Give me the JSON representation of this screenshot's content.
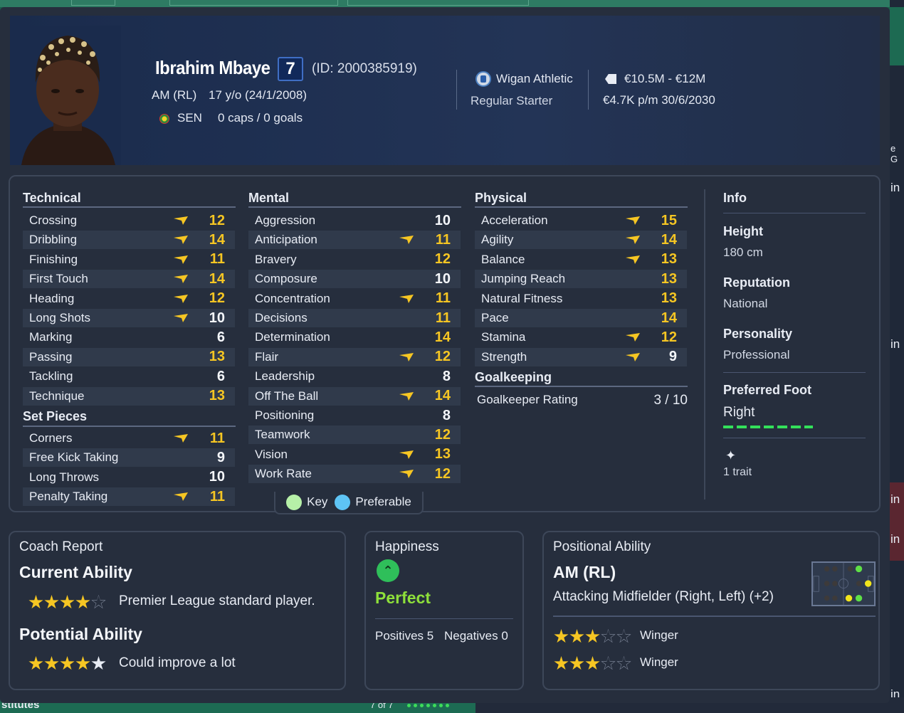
{
  "player": {
    "name": "Ibrahim Mbaye",
    "shirt_number": "7",
    "id_text": "(ID: 2000385919)",
    "position": "AM (RL)",
    "age_dob": "17 y/o (24/1/2008)",
    "nationality": "SEN",
    "caps_goals": "0 caps / 0 goals"
  },
  "club": {
    "name": "Wigan Athletic",
    "status": "Regular Starter",
    "value": "€10.5M - €12M",
    "wage_contract": "€4.7K p/m  30/6/2030"
  },
  "colors": {
    "highlight": "#f6c623",
    "normal": "#f4f6fa",
    "accent_green": "#33e05a",
    "key_dot": "#b6f0a8",
    "preferable_dot": "#5ec4f5"
  },
  "technical": {
    "title": "Technical",
    "rows": [
      {
        "label": "Crossing",
        "value": "12",
        "arrow": true,
        "hl": true
      },
      {
        "label": "Dribbling",
        "value": "14",
        "arrow": true,
        "hl": true
      },
      {
        "label": "Finishing",
        "value": "11",
        "arrow": true,
        "hl": true
      },
      {
        "label": "First Touch",
        "value": "14",
        "arrow": true,
        "hl": true
      },
      {
        "label": "Heading",
        "value": "12",
        "arrow": true,
        "hl": true
      },
      {
        "label": "Long Shots",
        "value": "10",
        "arrow": true,
        "hl": false
      },
      {
        "label": "Marking",
        "value": "6",
        "arrow": false,
        "hl": false
      },
      {
        "label": "Passing",
        "value": "13",
        "arrow": false,
        "hl": true
      },
      {
        "label": "Tackling",
        "value": "6",
        "arrow": false,
        "hl": false
      },
      {
        "label": "Technique",
        "value": "13",
        "arrow": false,
        "hl": true
      }
    ]
  },
  "set_pieces": {
    "title": "Set Pieces",
    "rows": [
      {
        "label": "Corners",
        "value": "11",
        "arrow": true,
        "hl": true
      },
      {
        "label": "Free Kick Taking",
        "value": "9",
        "arrow": false,
        "hl": false
      },
      {
        "label": "Long Throws",
        "value": "10",
        "arrow": false,
        "hl": false
      },
      {
        "label": "Penalty Taking",
        "value": "11",
        "arrow": true,
        "hl": true
      }
    ]
  },
  "mental": {
    "title": "Mental",
    "rows": [
      {
        "label": "Aggression",
        "value": "10",
        "arrow": false,
        "hl": false
      },
      {
        "label": "Anticipation",
        "value": "11",
        "arrow": true,
        "hl": true
      },
      {
        "label": "Bravery",
        "value": "12",
        "arrow": false,
        "hl": true
      },
      {
        "label": "Composure",
        "value": "10",
        "arrow": false,
        "hl": false
      },
      {
        "label": "Concentration",
        "value": "11",
        "arrow": true,
        "hl": true
      },
      {
        "label": "Decisions",
        "value": "11",
        "arrow": false,
        "hl": true
      },
      {
        "label": "Determination",
        "value": "14",
        "arrow": false,
        "hl": true
      },
      {
        "label": "Flair",
        "value": "12",
        "arrow": true,
        "hl": true
      },
      {
        "label": "Leadership",
        "value": "8",
        "arrow": false,
        "hl": false
      },
      {
        "label": "Off The Ball",
        "value": "14",
        "arrow": true,
        "hl": true
      },
      {
        "label": "Positioning",
        "value": "8",
        "arrow": false,
        "hl": false
      },
      {
        "label": "Teamwork",
        "value": "12",
        "arrow": false,
        "hl": true
      },
      {
        "label": "Vision",
        "value": "13",
        "arrow": true,
        "hl": true
      },
      {
        "label": "Work Rate",
        "value": "12",
        "arrow": true,
        "hl": true
      }
    ]
  },
  "physical": {
    "title": "Physical",
    "rows": [
      {
        "label": "Acceleration",
        "value": "15",
        "arrow": true,
        "hl": true
      },
      {
        "label": "Agility",
        "value": "14",
        "arrow": true,
        "hl": true
      },
      {
        "label": "Balance",
        "value": "13",
        "arrow": true,
        "hl": true
      },
      {
        "label": "Jumping Reach",
        "value": "13",
        "arrow": false,
        "hl": true
      },
      {
        "label": "Natural Fitness",
        "value": "13",
        "arrow": false,
        "hl": true
      },
      {
        "label": "Pace",
        "value": "14",
        "arrow": false,
        "hl": true
      },
      {
        "label": "Stamina",
        "value": "12",
        "arrow": true,
        "hl": true
      },
      {
        "label": "Strength",
        "value": "9",
        "arrow": true,
        "hl": false
      }
    ]
  },
  "goalkeeping": {
    "title": "Goalkeeping",
    "rating_label": "Goalkeeper Rating",
    "rating_value": "3 / 10"
  },
  "info": {
    "title": "Info",
    "height_label": "Height",
    "height_value": "180 cm",
    "reputation_label": "Reputation",
    "reputation_value": "National",
    "personality_label": "Personality",
    "personality_value": "Professional",
    "foot_label": "Preferred Foot",
    "foot_value": "Right",
    "traits": "1 trait"
  },
  "legend": {
    "key": "Key",
    "preferable": "Preferable"
  },
  "coach_report": {
    "title": "Coach Report",
    "current_label": "Current Ability",
    "current_stars": 4,
    "current_text": "Premier League standard player.",
    "potential_label": "Potential Ability",
    "potential_stars": 5,
    "potential_text": "Could improve a lot"
  },
  "happiness": {
    "title": "Happiness",
    "state": "Perfect",
    "positives_label": "Positives",
    "positives": "5",
    "negatives_label": "Negatives",
    "negatives": "0"
  },
  "positional": {
    "title": "Positional Ability",
    "position": "AM (RL)",
    "description": "Attacking Midfielder (Right, Left) (+2)",
    "roles": [
      {
        "name": "Winger",
        "stars": 3
      },
      {
        "name": "Winger",
        "stars": 3
      }
    ]
  },
  "background": {
    "bottom_text": "stitutes",
    "bottom_count": "7 of 7",
    "right_frags": [
      "e G",
      "in",
      "in",
      "in",
      "in",
      "in"
    ]
  }
}
